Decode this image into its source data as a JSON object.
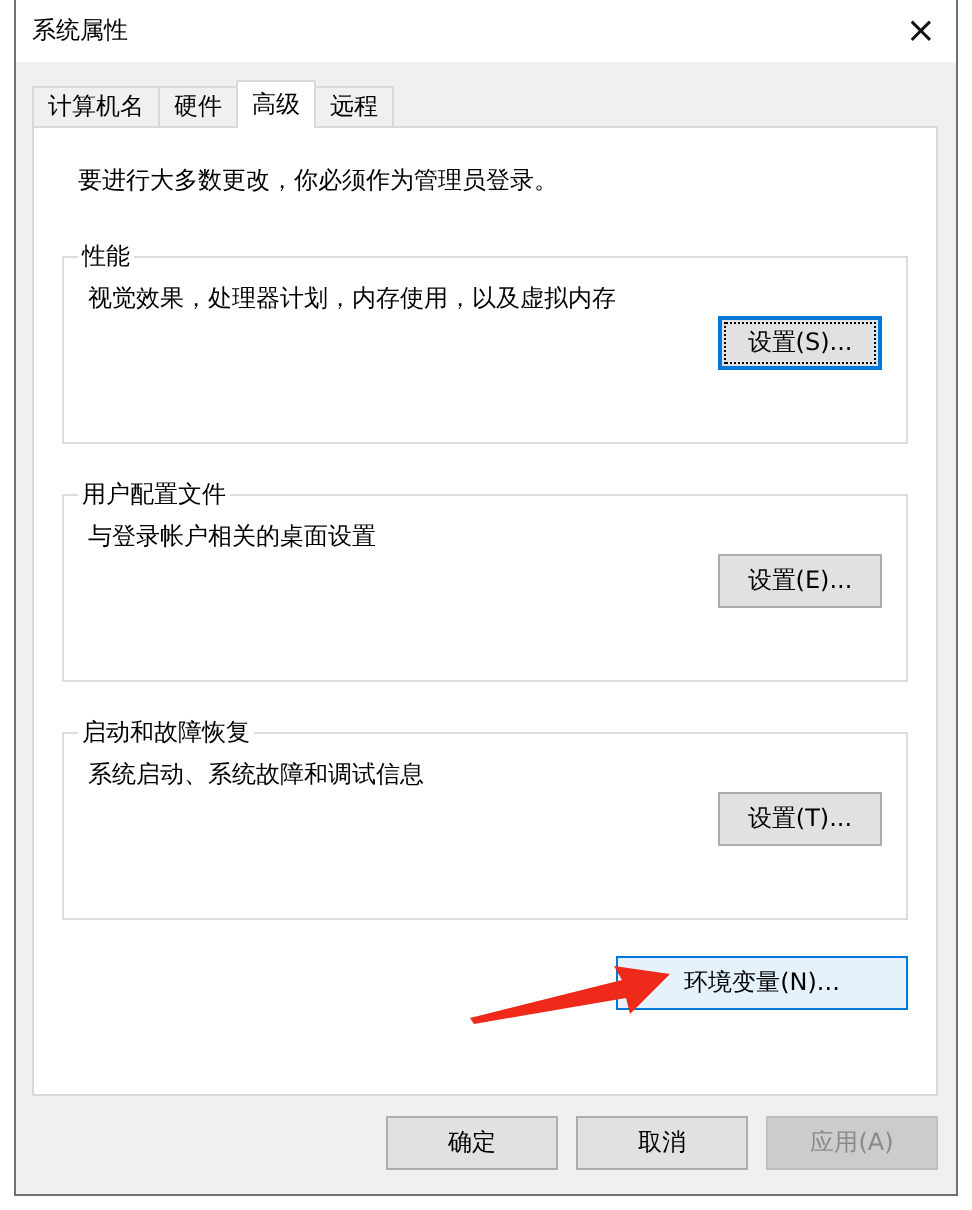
{
  "window": {
    "title": "系统属性",
    "close": "×"
  },
  "tabs": [
    {
      "label": "计算机名",
      "selected": false
    },
    {
      "label": "硬件",
      "selected": false
    },
    {
      "label": "高级",
      "selected": true
    },
    {
      "label": "远程",
      "selected": false
    }
  ],
  "notice": "要进行大多数更改，你必须作为管理员登录。",
  "groups": [
    {
      "title": "性能",
      "description": "视觉效果，处理器计划，内存使用，以及虚拟内存",
      "button": {
        "label": "设置(S)...",
        "focused": true
      }
    },
    {
      "title": "用户配置文件",
      "description": "与登录帐户相关的桌面设置",
      "button": {
        "label": "设置(E)...",
        "focused": false
      }
    },
    {
      "title": "启动和故障恢复",
      "description": "系统启动、系统故障和调试信息",
      "button": {
        "label": "设置(T)...",
        "focused": false
      }
    }
  ],
  "environment_button": {
    "label": "环境变量(N)...",
    "highlighted": true
  },
  "buttons": [
    {
      "label": "确定",
      "disabled": false
    },
    {
      "label": "取消",
      "disabled": false
    },
    {
      "label": "应用(A)",
      "disabled": true
    }
  ]
}
